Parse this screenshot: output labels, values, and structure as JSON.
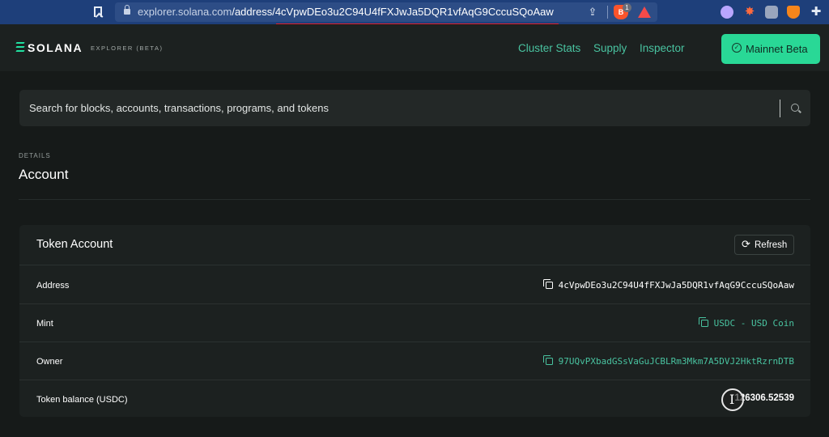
{
  "browser": {
    "url_host": "explorer.solana.com",
    "url_path": "/address/4cVpwDEo3u2C94U4fFXJwJa5DQR1vfAqG9CccuSQoAaw",
    "brave_badge": "1",
    "icons": [
      "bookmark-icon",
      "lock-icon",
      "share-icon",
      "brave-shield-icon",
      "brave-rewards-icon",
      "extension-icons",
      "puzzle-icon"
    ]
  },
  "header": {
    "logo": "SOLANA",
    "logo_sub": "EXPLORER (BETA)",
    "nav": [
      "Cluster Stats",
      "Supply",
      "Inspector"
    ],
    "cluster_button": "Mainnet Beta",
    "accent": "#29d896",
    "link_color": "#49c3a0"
  },
  "search": {
    "placeholder": "Search for blocks, accounts, transactions, programs, and tokens"
  },
  "page": {
    "eyebrow": "DETAILS",
    "title": "Account"
  },
  "card": {
    "title": "Token Account",
    "refresh_label": "Refresh",
    "rows": [
      {
        "label": "Address",
        "value": "4cVpwDEo3u2C94U4fFXJwJa5DQR1vfAqG9CccuSQoAaw"
      },
      {
        "label": "Mint",
        "value": "USDC - USD Coin"
      },
      {
        "label": "Owner",
        "value": "97UQvPXbadGSsVaGuJCBLRm3Mkm7A5DVJ2HktRzrnDTB"
      },
      {
        "label": "Token balance (USDC)",
        "value": "126306.52539"
      }
    ]
  }
}
